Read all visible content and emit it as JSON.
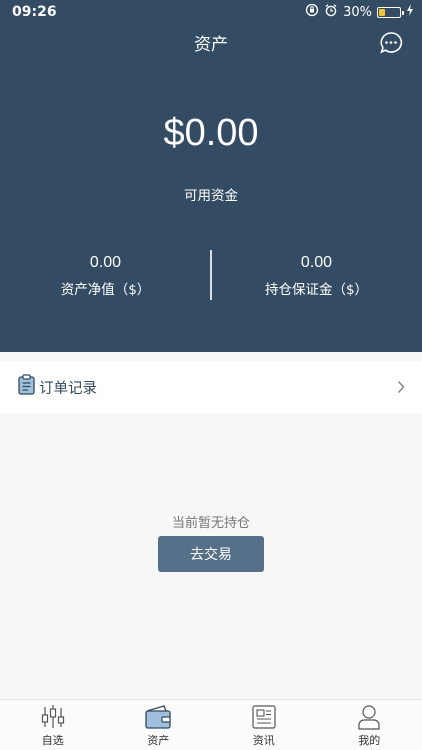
{
  "status_bar": {
    "time": "09:26",
    "battery_percent": "30%",
    "battery_level": 0.3
  },
  "header": {
    "title": "资产",
    "balance": "$0.00",
    "balance_label": "可用资金"
  },
  "stats": [
    {
      "value": "0.00",
      "label": "资产净值（$）"
    },
    {
      "value": "0.00",
      "label": "持仓保证金（$）"
    }
  ],
  "orders": {
    "label": "订单记录"
  },
  "empty_state": {
    "text": "当前暂无持仓",
    "button": "去交易"
  },
  "tabs": [
    {
      "label": "自选",
      "icon": "candlestick-icon"
    },
    {
      "label": "资产",
      "icon": "wallet-icon",
      "active": true
    },
    {
      "label": "资讯",
      "icon": "news-icon"
    },
    {
      "label": "我的",
      "icon": "user-icon"
    }
  ],
  "colors": {
    "header_bg": "#334b63",
    "button_bg": "#557088",
    "active_icon": "#9ec0dd",
    "battery": "#f5c431"
  }
}
